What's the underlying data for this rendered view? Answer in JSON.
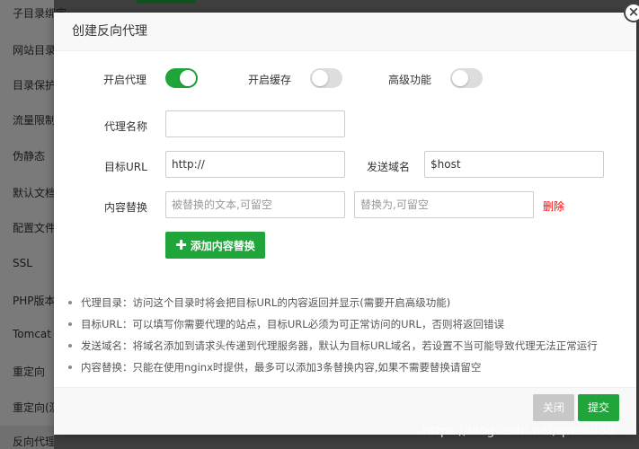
{
  "sidebar": {
    "items": [
      "子目录绑定",
      "网站目录",
      "目录保护",
      "流量限制",
      "伪静态",
      "默认文档",
      "配置文件",
      "SSL",
      "PHP版本",
      "Tomcat",
      "重定向",
      "重定向(测试版)",
      "反向代理"
    ],
    "active": "反向代理"
  },
  "modal": {
    "title": "创建反向代理",
    "close_icon": "×",
    "toggles": {
      "proxy_label": "开启代理",
      "proxy_on": true,
      "cache_label": "开启缓存",
      "cache_on": false,
      "advanced_label": "高级功能",
      "advanced_on": false
    },
    "form": {
      "name_label": "代理名称",
      "name_value": "",
      "target_label": "目标URL",
      "target_value": "http://",
      "domain_label": "发送域名",
      "domain_value": "$host",
      "replace_label": "内容替换",
      "replace_from_placeholder": "被替换的文本,可留空",
      "replace_to_placeholder": "替换为,可留空",
      "delete_label": "删除",
      "add_button": "添加内容替换"
    },
    "tips": [
      "代理目录：访问这个目录时将会把目标URL的内容返回并显示(需要开启高级功能)",
      "目标URL：可以填写你需要代理的站点，目标URL必须为可正常访问的URL，否则将返回错误",
      "发送域名：将域名添加到请求头传递到代理服务器，默认为目标URL域名，若设置不当可能导致代理无法正常运行",
      "内容替换：只能在使用nginx时提供，最多可以添加3条替换内容,如果不需要替换请留空"
    ],
    "footer": {
      "close_label": "关闭",
      "submit_label": "提交"
    }
  },
  "watermark": "https://blog.csdn.net/qwex888",
  "colors": {
    "accent": "#20a53a",
    "danger": "#ff0000",
    "disabled": "#c7c7c7"
  }
}
